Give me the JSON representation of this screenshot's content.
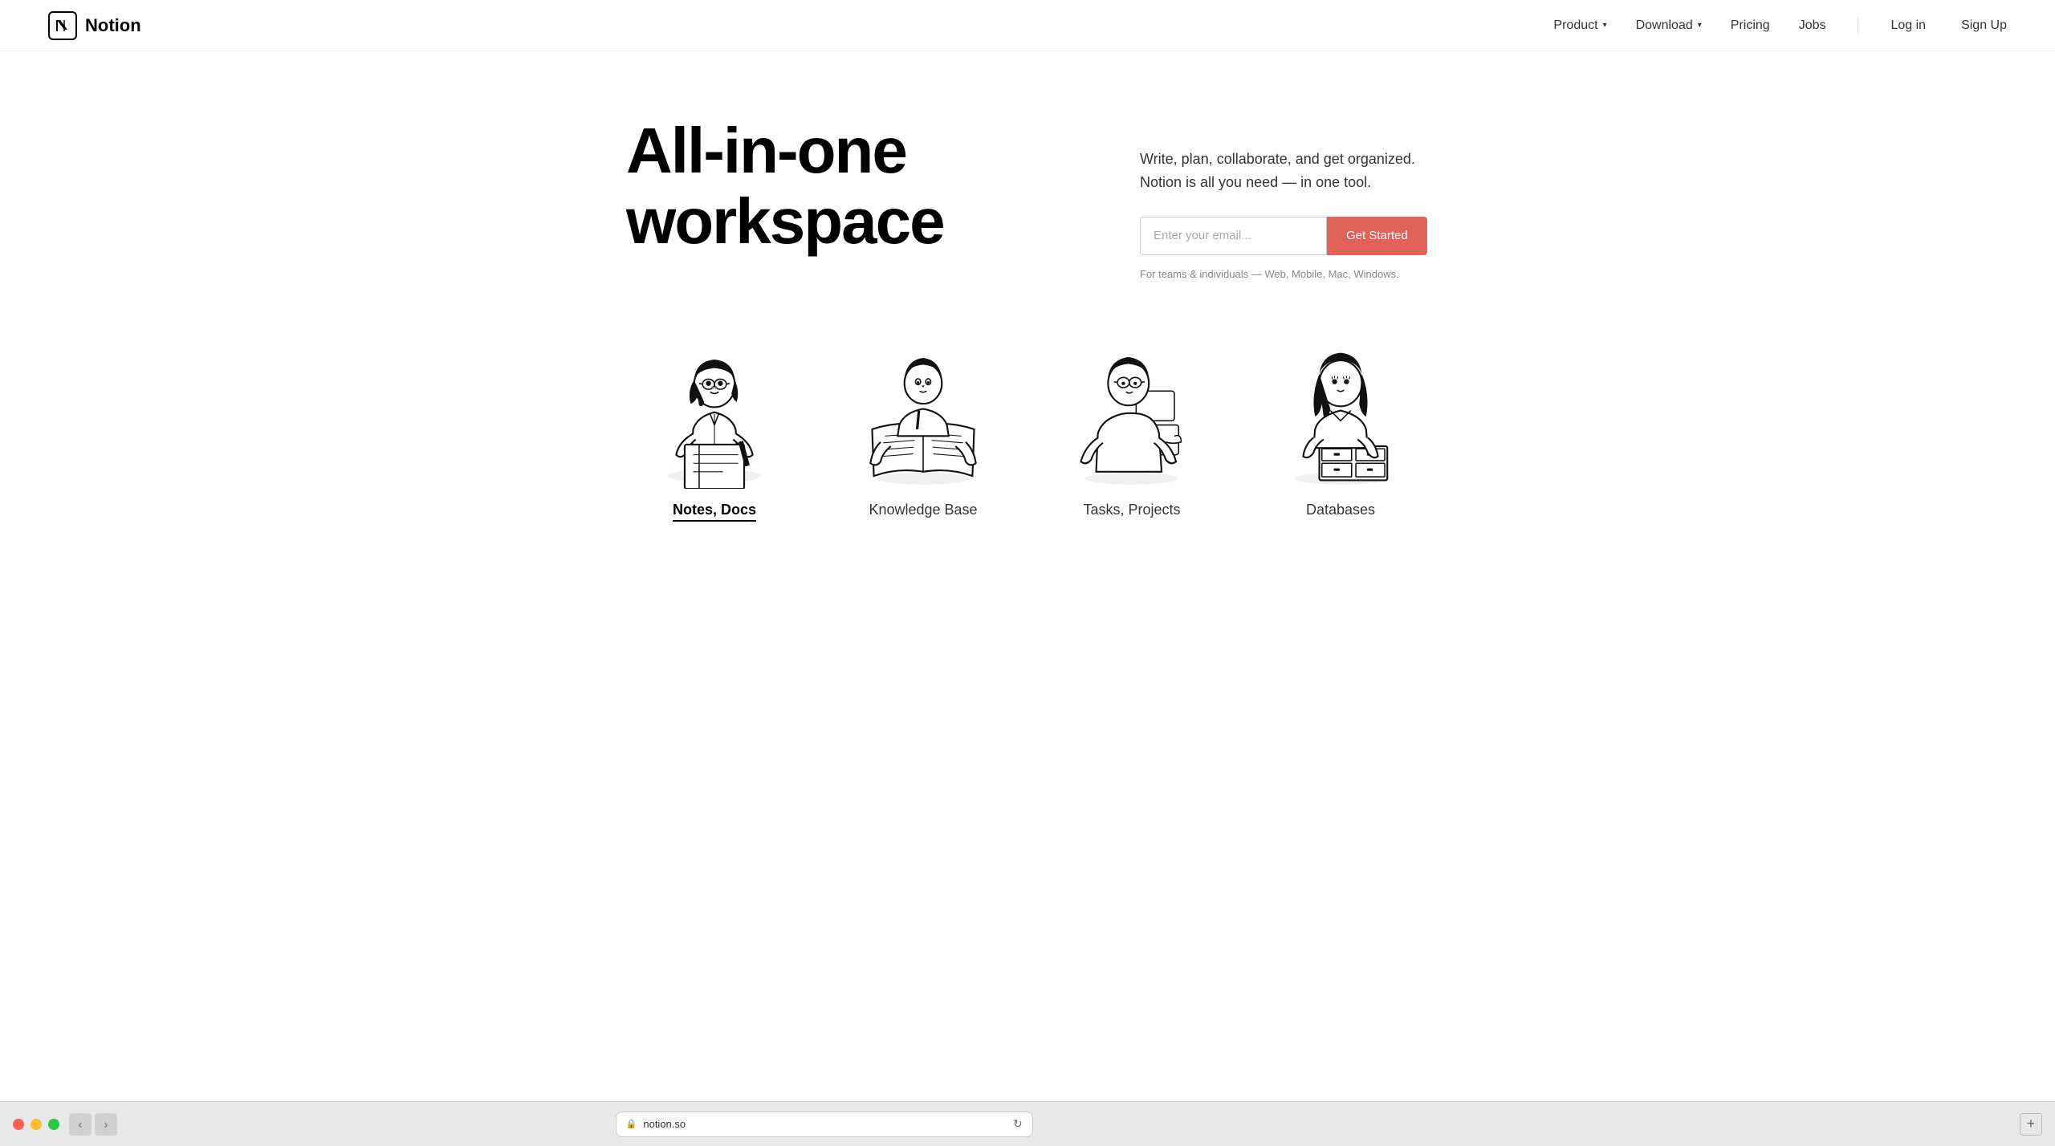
{
  "browser": {
    "url": "notion.so",
    "reload_icon": "↻"
  },
  "navbar": {
    "logo_text": "Notion",
    "logo_initial": "N",
    "nav_items": [
      {
        "label": "Product",
        "has_dropdown": true
      },
      {
        "label": "Download",
        "has_dropdown": true
      },
      {
        "label": "Pricing",
        "has_dropdown": false
      },
      {
        "label": "Jobs",
        "has_dropdown": false
      }
    ],
    "login_label": "Log in",
    "signup_label": "Sign Up"
  },
  "hero": {
    "title": "All-in-one workspace",
    "description_line1": "Write, plan, collaborate, and get organized.",
    "description_line2": "Notion is all you need — in one tool.",
    "email_placeholder": "Enter your email...",
    "cta_label": "Get Started",
    "platforms_text": "For teams & individuals — Web, Mobile, Mac, Windows."
  },
  "features": [
    {
      "label": "Notes, Docs",
      "active": true
    },
    {
      "label": "Knowledge Base",
      "active": false
    },
    {
      "label": "Tasks, Projects",
      "active": false
    },
    {
      "label": "Databases",
      "active": false
    }
  ],
  "colors": {
    "cta_bg": "#e16259",
    "cta_text": "#ffffff",
    "active_underline": "#000000"
  }
}
